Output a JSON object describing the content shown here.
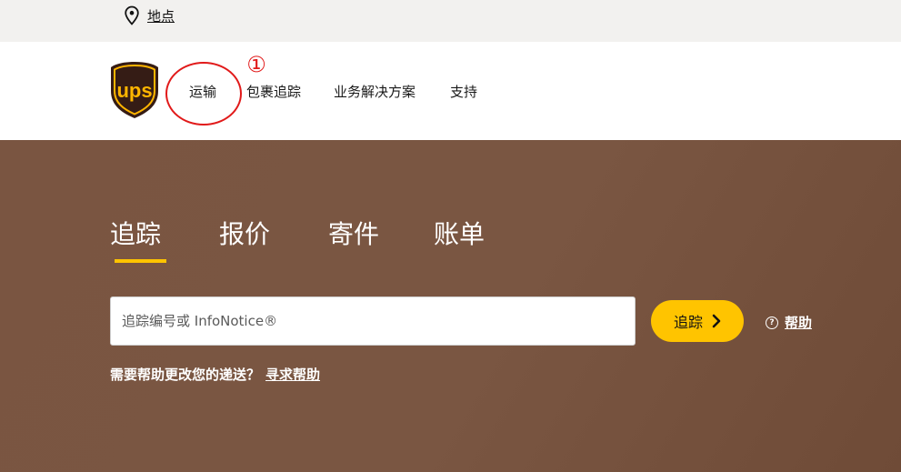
{
  "topbar": {
    "location_label": "地点"
  },
  "nav": {
    "logo_text": "ups",
    "items": [
      {
        "label": "运输"
      },
      {
        "label": "包裹追踪"
      },
      {
        "label": "业务解决方案"
      },
      {
        "label": "支持"
      }
    ],
    "annotation_number": "①"
  },
  "hero": {
    "tabs": [
      {
        "label": "追踪"
      },
      {
        "label": "报价"
      },
      {
        "label": "寄件"
      },
      {
        "label": "账单"
      }
    ],
    "search": {
      "placeholder": "追踪编号或 InfoNotice®",
      "value": ""
    },
    "track_button_label": "追踪",
    "help_icon_glyph": "?",
    "help_link": "帮助",
    "note_text": "需要帮助更改您的递送？",
    "note_link": "寻求帮助"
  },
  "colors": {
    "brand_brown": "#351c15",
    "brand_gold": "#ffb500",
    "accent_yellow": "#ffc400",
    "hero_brown": "#7a5541",
    "annotation_red": "#e11a1a"
  }
}
